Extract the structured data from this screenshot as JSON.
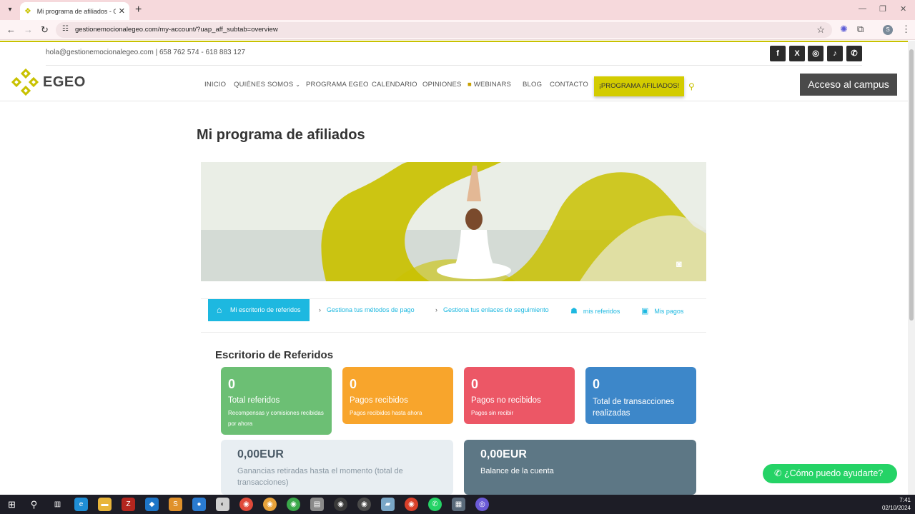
{
  "browser": {
    "tab_title": "Mi programa de afiliados - Gest",
    "url": "gestionemocionalegeo.com/my-account/?uap_aff_subtab=overview",
    "profile_initial": "S"
  },
  "topbar": {
    "contact": "hola@gestionemocionalegeo.com | 658 762 574 - 618 883 127",
    "social": [
      "f",
      "X",
      "◎",
      "♪",
      "✆"
    ]
  },
  "header": {
    "logo": "EGEO",
    "nav": [
      "INICIO",
      "QUIÉNES SOMOS",
      "PROGRAMA EGEO",
      "CALENDARIO",
      "OPINIONES",
      "WEBINARS",
      "BLOG",
      "CONTACTO"
    ],
    "cta": "¡PROGRAMA AFILIADOS!",
    "campus_button": "Acceso al campus"
  },
  "page": {
    "title": "Mi programa de afiliados"
  },
  "aff_tabs": {
    "active": "Mi escritorio de referidos",
    "items": [
      "Gestiona tus métodos de pago",
      "Gestiona tus enlaces de seguimiento",
      "mis referidos",
      "Mis pagos"
    ]
  },
  "dashboard": {
    "title": "Escritorio de Referidos",
    "cards": [
      {
        "value": "0",
        "label": "Total referidos",
        "sub": "Recompensas y comisiones recibidas por ahora",
        "color": "#6cbf74"
      },
      {
        "value": "0",
        "label": "Pagos recibidos",
        "sub": "Pagos recibidos hasta ahora",
        "color": "#f8a52c"
      },
      {
        "value": "0",
        "label": "Pagos no recibidos",
        "sub": "Pagos sin recibir",
        "color": "#ec5766"
      },
      {
        "value": "0",
        "label": "Total de transacciones realizadas",
        "sub": "",
        "color": "#3d87c9"
      }
    ],
    "balance_cards": [
      {
        "amount": "0,00EUR",
        "label": "Ganancias retiradas hasta el momento (total de transacciones)",
        "color": "#e8eef2"
      },
      {
        "amount": "0,00EUR",
        "label": "Balance de la cuenta",
        "color": "#5d7785"
      }
    ]
  },
  "whatsapp": {
    "label": "¿Cómo puedo ayudarte?"
  },
  "taskbar": {
    "time": "7:41",
    "date": "02/10/2024"
  }
}
